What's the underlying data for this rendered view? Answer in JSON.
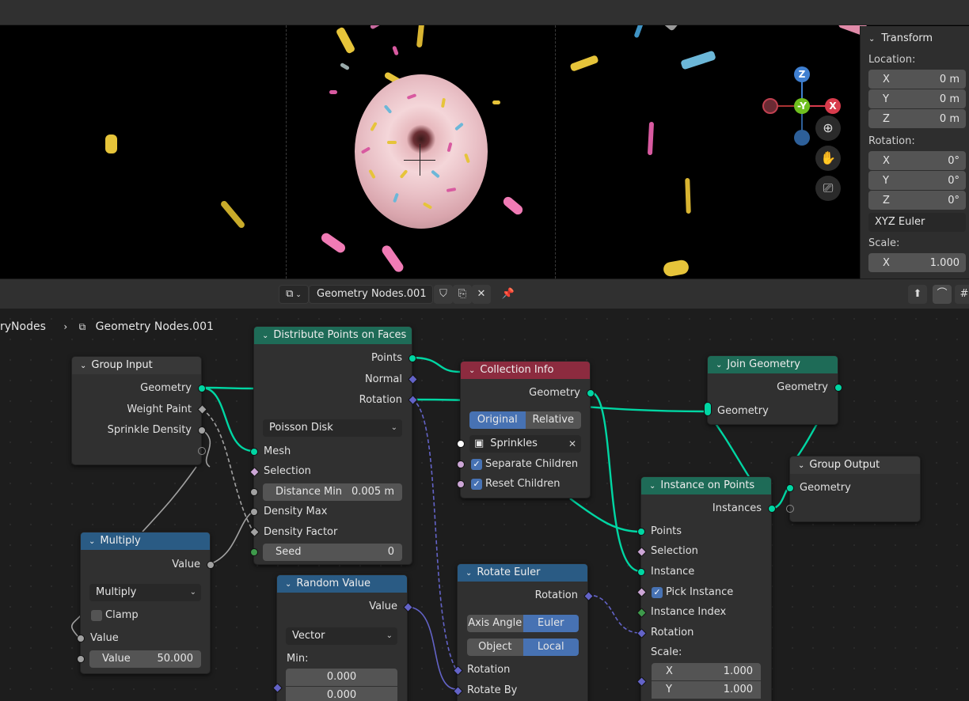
{
  "transform_panel": {
    "title": "Transform",
    "location_label": "Location:",
    "location": [
      {
        "axis": "X",
        "value": "0 m"
      },
      {
        "axis": "Y",
        "value": "0 m"
      },
      {
        "axis": "Z",
        "value": "0 m"
      }
    ],
    "rotation_label": "Rotation:",
    "rotation": [
      {
        "axis": "X",
        "value": "0°"
      },
      {
        "axis": "Y",
        "value": "0°"
      },
      {
        "axis": "Z",
        "value": "0°"
      }
    ],
    "rotation_mode": "XYZ Euler",
    "scale_label": "Scale:",
    "scale": [
      {
        "axis": "X",
        "value": "1.000"
      }
    ]
  },
  "gizmo": {
    "z": "Z",
    "y": "-Y",
    "x": "X"
  },
  "node_header": {
    "node_group_name": "Geometry Nodes.001"
  },
  "breadcrumb": {
    "parent": "ryNodes",
    "current": "Geometry Nodes.001"
  },
  "nodes": {
    "group_input": {
      "title": "Group Input",
      "geometry": "Geometry",
      "weight_paint": "Weight Paint",
      "sprinkle_density": "Sprinkle Density"
    },
    "distribute": {
      "title": "Distribute Points on Faces",
      "points": "Points",
      "normal": "Normal",
      "rotation": "Rotation",
      "mode": "Poisson Disk",
      "mesh": "Mesh",
      "selection": "Selection",
      "distance_min_label": "Distance Min",
      "distance_min_value": "0.005 m",
      "density_max": "Density Max",
      "density_factor": "Density Factor",
      "seed_label": "Seed",
      "seed_value": "0"
    },
    "collection_info": {
      "title": "Collection Info",
      "geometry": "Geometry",
      "original": "Original",
      "relative": "Relative",
      "collection": "Sprinkles",
      "separate_children": "Separate Children",
      "reset_children": "Reset Children"
    },
    "join_geometry": {
      "title": "Join Geometry",
      "out_geometry": "Geometry",
      "in_geometry": "Geometry"
    },
    "group_output": {
      "title": "Group Output",
      "geometry": "Geometry"
    },
    "instance_on_points": {
      "title": "Instance on Points",
      "instances": "Instances",
      "points": "Points",
      "selection": "Selection",
      "instance": "Instance",
      "pick_instance": "Pick Instance",
      "instance_index": "Instance Index",
      "rotation": "Rotation",
      "scale_label": "Scale:",
      "scale_x_label": "X",
      "scale_x_value": "1.000",
      "scale_y_label": "Y",
      "scale_y_value": "1.000"
    },
    "multiply": {
      "title": "Multiply",
      "value_out": "Value",
      "operation": "Multiply",
      "clamp": "Clamp",
      "value_in": "Value",
      "value_field_label": "Value",
      "value_field_value": "50.000"
    },
    "random_value": {
      "title": "Random Value",
      "value": "Value",
      "type": "Vector",
      "min_label": "Min:",
      "min_0": "0.000",
      "min_1": "0.000"
    },
    "rotate_euler": {
      "title": "Rotate Euler",
      "rotation_out": "Rotation",
      "axis_angle": "Axis Angle",
      "euler": "Euler",
      "object": "Object",
      "local": "Local",
      "rotation_in": "Rotation",
      "rotate_by": "Rotate By"
    }
  }
}
